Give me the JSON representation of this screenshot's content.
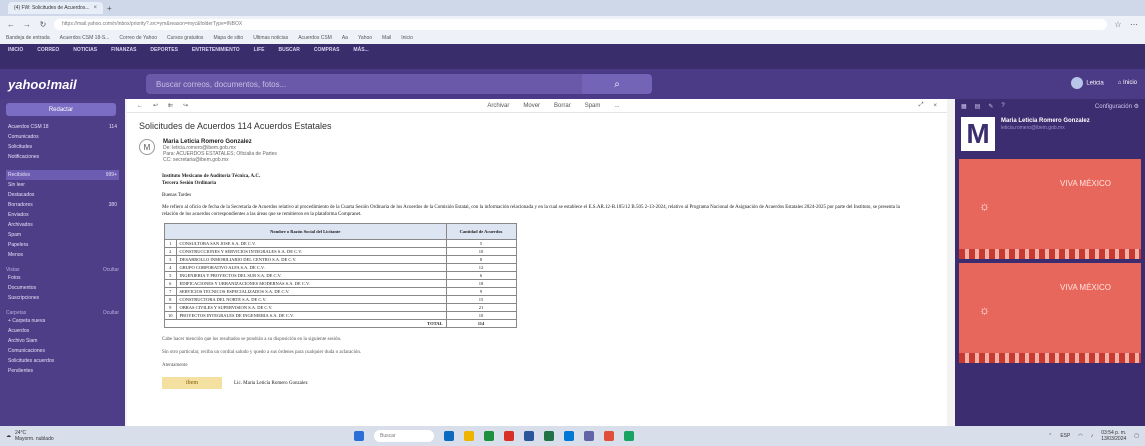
{
  "browser": {
    "tab_label": "(4) FW: Solicitudes de Acuerdos...",
    "url": "https://mail.yahoo.com/n/inbox/priority?.src=ym&reason=myc&folderType=INBOX",
    "bookmarks": [
      "Bandeja de entrada",
      "Acuerdos CSM 18-S...",
      "Correo de Yahoo",
      "Cursos gratuitos",
      "Mapa de sitio",
      "Ultimas noticias",
      "Acuerdos CSM",
      "Aa",
      "Yahoo",
      "Mail",
      "Inicio"
    ]
  },
  "yahoo": {
    "topnav": [
      "INICIO",
      "CORREO",
      "NOTICIAS",
      "FINANZAS",
      "DEPORTES",
      "ENTRETENIMIENTO",
      "LIFE",
      "BUSCAR",
      "COMPRAS",
      "MÁS..."
    ],
    "logo": "yahoo!mail",
    "search_placeholder": "Buscar correos, documentos, fotos...",
    "search_icon": "search-icon",
    "user_name": "Leticia",
    "home_label": "Inicio"
  },
  "sidebar": {
    "compose_label": "Redactar",
    "folders": [
      {
        "label": "Acuerdos CSM 18",
        "count": "114"
      },
      {
        "label": "Comunicados",
        "count": ""
      },
      {
        "label": "Solicitudes",
        "count": ""
      },
      {
        "label": "Notificaciones",
        "count": ""
      }
    ],
    "mailbox": [
      {
        "label": "Recibidos",
        "count": "999+"
      },
      {
        "label": "Sin leer",
        "count": ""
      },
      {
        "label": "Destacados",
        "count": ""
      },
      {
        "label": "Borradores",
        "count": "380"
      },
      {
        "label": "Enviados",
        "count": ""
      },
      {
        "label": "Archivados",
        "count": ""
      },
      {
        "label": "Spam",
        "count": ""
      },
      {
        "label": "Papelera",
        "count": ""
      },
      {
        "label": "Menos",
        "count": ""
      }
    ],
    "views_label": "Vistas",
    "views_action": "Ocultar",
    "views": [
      "Fotos",
      "Documentos",
      "Suscripciones"
    ],
    "folders_label": "Carpetas",
    "folders_action": "Ocultar",
    "user_folders": [
      "+ Carpeta nueva",
      "Acuerdos",
      "Archivo Siam",
      "Comunicaciones",
      "Solicitudes acuerdos",
      "Pendientes"
    ]
  },
  "mail": {
    "toolbar": [
      "Archivar",
      "Mover",
      "Borrar",
      "Spam",
      "..."
    ],
    "subject": "Solicitudes de Acuerdos 114 Acuerdos Estatales",
    "sender_name": "Maria Leticia Romero Gonzalez",
    "sender_lines": [
      "De: leticia.romero@ibem.gob.mx",
      "Para: ACUERDOS ESTATALES; Oficialia de Partes",
      "CC: secretaria@ibem.gob.mx"
    ],
    "greeting_org": "Instituto Mexicano de Auditoría Técnica, A.C.",
    "greeting_title": "Tercera Sesión Ordinaria",
    "salutation": "Buenas Tardes",
    "paragraph": "Me refiero al oficio de fecha de la Secretaría de Acuerdos relativo al procedimiento de la Cuarta Sesión Ordinaria de los Acuerdos de la Comisión Estatal, con la información relacionada y en la cual se establece el E.S.AR.12-B.105/12 B.505 2-13-2024, relativo al Programa Nacional de Asignación de Acuerdos Estatales 2024-2025 por parte del Instituto, se presenta la relación de los acuerdos correspondientes a las áreas que se remitieron en la plataforma Compranet.",
    "table": {
      "headers": [
        "Nombre o Razón Social del Licitante",
        "Cantidad de Acuerdos"
      ],
      "rows": [
        {
          "n": "1",
          "name": "CONSULTORA SAN JOSE S.A. DE C.V.",
          "count": "5"
        },
        {
          "n": "2",
          "name": "CONSTRUCCIONES Y SERVICIOS INTEGRALES S.A. DE C.V.",
          "count": "10"
        },
        {
          "n": "3",
          "name": "DESARROLLO INMOBILIARIO DEL CENTRO S.A. DE C.V.",
          "count": "8"
        },
        {
          "n": "4",
          "name": "GRUPO CORPORATIVO ALFA S.A. DE C.V.",
          "count": "12"
        },
        {
          "n": "5",
          "name": "INGENIERIA Y PROYECTOS DEL SUR S.A. DE C.V.",
          "count": "6"
        },
        {
          "n": "6",
          "name": "EDIFICACIONES Y URBANIZACIONES MODERNAS S.A. DE C.V.",
          "count": "18"
        },
        {
          "n": "7",
          "name": "SERVICIOS TECNICOS ESPECIALIZADOS S.A. DE C.V.",
          "count": "9"
        },
        {
          "n": "8",
          "name": "CONSTRUCTORA DEL NORTE S.A. DE C.V.",
          "count": "15"
        },
        {
          "n": "9",
          "name": "OBRAS CIVILES Y SUPERVISION S.A. DE C.V.",
          "count": "21"
        },
        {
          "n": "10",
          "name": "PROYECTOS INTEGRALES DE INGENIERIA S.A. DE C.V.",
          "count": "10"
        }
      ],
      "total_label": "TOTAL",
      "total": "114"
    },
    "after_1": "Cabe hacer mención que los resultados se pondrán a su disposición en la siguiente sesión.",
    "after_2": "Sin otro particular, reciba un cordial saludo y quedo a sus órdenes para cualquier duda o aclaración.",
    "closing": "Atentamente",
    "signature_logo": "ibem",
    "signature_name": "Lic. Maria Leticia Romero Gonzalez"
  },
  "right": {
    "config_label": "Configuración",
    "profile_initial": "M",
    "profile_name": "Maria Leticia Romero Gonzalez",
    "profile_email": "leticia.romero@ibem.gob.mx",
    "ad_title": "VIVA MÉXICO",
    "ad_symbol": "☼"
  },
  "taskbar": {
    "weather": "24°C",
    "weather_sub": "Mayorm. nublado",
    "search_label": "Buscar",
    "time": "03:54 p. m.",
    "date": "13/03/2024",
    "lang": "ESP"
  }
}
